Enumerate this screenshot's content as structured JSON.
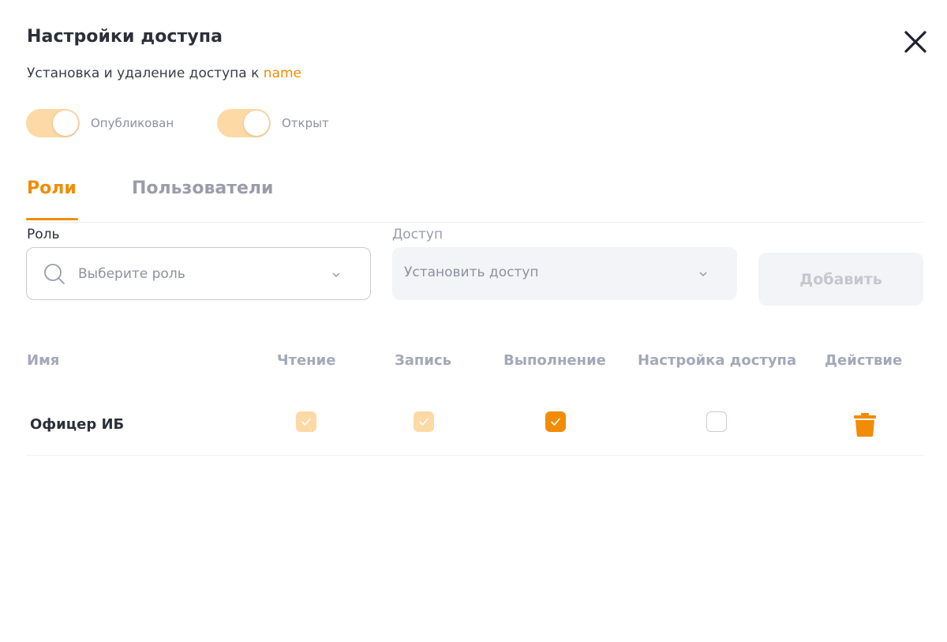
{
  "dialog": {
    "title": "Настройки доступа",
    "subtitle_prefix": "Установка и удаление доступа к ",
    "subtitle_entity": "name",
    "accent_color": "#f28c06",
    "close_icon": "close-icon"
  },
  "toggles": [
    {
      "label": "Опубликован",
      "on": true
    },
    {
      "label": "Открыт",
      "on": true
    }
  ],
  "tabs": [
    {
      "label": "Роли",
      "active": true
    },
    {
      "label": "Пользователи",
      "active": false
    }
  ],
  "form": {
    "role_label": "Роль",
    "role_placeholder": "Выберите роль",
    "access_label": "Доступ",
    "access_placeholder": "Установить доступ",
    "add_button": "Добавить"
  },
  "table": {
    "headers": [
      "Имя",
      "Чтение",
      "Запись",
      "Выполнение",
      "Настройка доступа",
      "Действие"
    ],
    "rows": [
      {
        "name": "Офицер ИБ",
        "read": "checked-disabled",
        "write": "checked-disabled",
        "execute": "checked",
        "access_settings": "unchecked",
        "action_icon": "trash-icon"
      }
    ]
  }
}
